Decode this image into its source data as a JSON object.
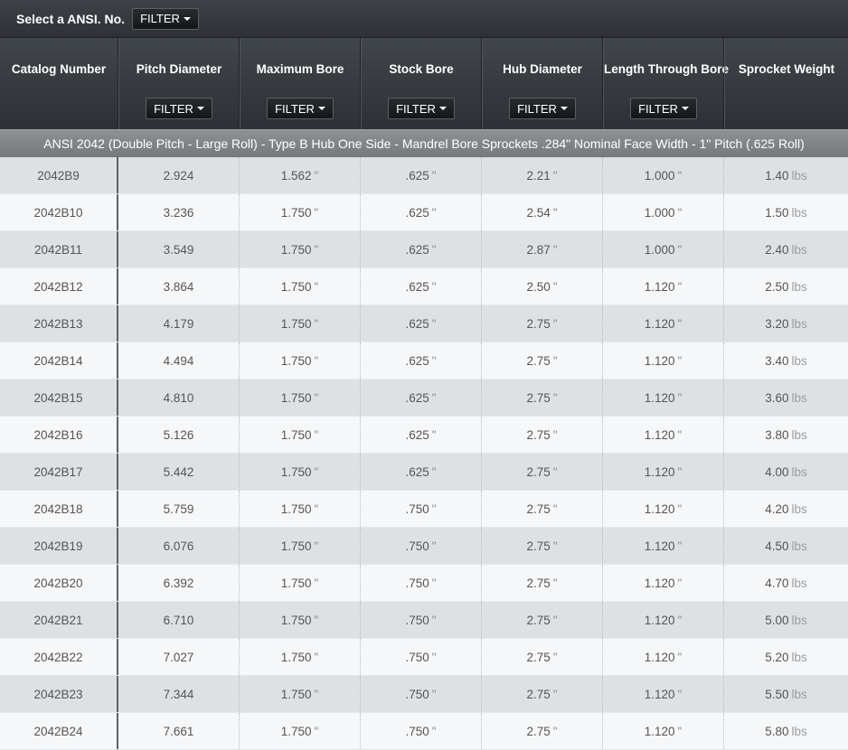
{
  "topbar": {
    "label": "Select a ANSI. No.",
    "filter_label": "FILTER"
  },
  "columns": [
    {
      "label": "Catalog Number",
      "filter": ""
    },
    {
      "label": "Pitch Diameter",
      "filter": "FILTER"
    },
    {
      "label": "Maximum Bore",
      "filter": "FILTER"
    },
    {
      "label": "Stock Bore",
      "filter": "FILTER"
    },
    {
      "label": "Hub Diameter",
      "filter": "FILTER"
    },
    {
      "label": "Length Through Bore",
      "filter": "FILTER"
    },
    {
      "label": "Sprocket Weight",
      "filter": ""
    }
  ],
  "group_title": "ANSI 2042 (Double Pitch - Large Roll) - Type B Hub One Side - Mandrel Bore Sprockets .284\" Nominal Face Width - 1\" Pitch (.625 Roll)",
  "units": {
    "inch": "\"",
    "lbs": "lbs"
  },
  "rows": [
    {
      "catalog": "2042B9",
      "pitch": "2.924",
      "max_bore": "1.562",
      "stock_bore": ".625",
      "hub": "2.21",
      "length": "1.000",
      "weight": "1.40"
    },
    {
      "catalog": "2042B10",
      "pitch": "3.236",
      "max_bore": "1.750",
      "stock_bore": ".625",
      "hub": "2.54",
      "length": "1.000",
      "weight": "1.50"
    },
    {
      "catalog": "2042B11",
      "pitch": "3.549",
      "max_bore": "1.750",
      "stock_bore": ".625",
      "hub": "2.87",
      "length": "1.000",
      "weight": "2.40"
    },
    {
      "catalog": "2042B12",
      "pitch": "3.864",
      "max_bore": "1.750",
      "stock_bore": ".625",
      "hub": "2.50",
      "length": "1.120",
      "weight": "2.50"
    },
    {
      "catalog": "2042B13",
      "pitch": "4.179",
      "max_bore": "1.750",
      "stock_bore": ".625",
      "hub": "2.75",
      "length": "1.120",
      "weight": "3.20"
    },
    {
      "catalog": "2042B14",
      "pitch": "4.494",
      "max_bore": "1.750",
      "stock_bore": ".625",
      "hub": "2.75",
      "length": "1.120",
      "weight": "3.40"
    },
    {
      "catalog": "2042B15",
      "pitch": "4.810",
      "max_bore": "1.750",
      "stock_bore": ".625",
      "hub": "2.75",
      "length": "1.120",
      "weight": "3.60"
    },
    {
      "catalog": "2042B16",
      "pitch": "5.126",
      "max_bore": "1.750",
      "stock_bore": ".625",
      "hub": "2.75",
      "length": "1.120",
      "weight": "3.80"
    },
    {
      "catalog": "2042B17",
      "pitch": "5.442",
      "max_bore": "1.750",
      "stock_bore": ".625",
      "hub": "2.75",
      "length": "1.120",
      "weight": "4.00"
    },
    {
      "catalog": "2042B18",
      "pitch": "5.759",
      "max_bore": "1.750",
      "stock_bore": ".750",
      "hub": "2.75",
      "length": "1.120",
      "weight": "4.20"
    },
    {
      "catalog": "2042B19",
      "pitch": "6.076",
      "max_bore": "1.750",
      "stock_bore": ".750",
      "hub": "2.75",
      "length": "1.120",
      "weight": "4.50"
    },
    {
      "catalog": "2042B20",
      "pitch": "6.392",
      "max_bore": "1.750",
      "stock_bore": ".750",
      "hub": "2.75",
      "length": "1.120",
      "weight": "4.70"
    },
    {
      "catalog": "2042B21",
      "pitch": "6.710",
      "max_bore": "1.750",
      "stock_bore": ".750",
      "hub": "2.75",
      "length": "1.120",
      "weight": "5.00"
    },
    {
      "catalog": "2042B22",
      "pitch": "7.027",
      "max_bore": "1.750",
      "stock_bore": ".750",
      "hub": "2.75",
      "length": "1.120",
      "weight": "5.20"
    },
    {
      "catalog": "2042B23",
      "pitch": "7.344",
      "max_bore": "1.750",
      "stock_bore": ".750",
      "hub": "2.75",
      "length": "1.120",
      "weight": "5.50"
    },
    {
      "catalog": "2042B24",
      "pitch": "7.661",
      "max_bore": "1.750",
      "stock_bore": ".750",
      "hub": "2.75",
      "length": "1.120",
      "weight": "5.80"
    }
  ]
}
